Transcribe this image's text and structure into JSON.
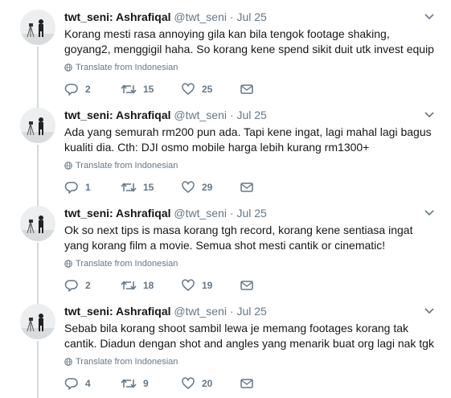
{
  "tweets": [
    {
      "display_name": "twt_seni: Ashrafiqal",
      "handle": "@twt_seni",
      "separator": "·",
      "date": "Jul 25",
      "text": "Korang mesti rasa annoying gila kan bila tengok footage shaking, goyang2, menggigil haha. So korang kene spend sikit duit utk invest equip",
      "translate_label": "Translate from Indonesian",
      "replies": "2",
      "retweets": "15",
      "likes": "25"
    },
    {
      "display_name": "twt_seni: Ashrafiqal",
      "handle": "@twt_seni",
      "separator": "·",
      "date": "Jul 25",
      "text": "Ada yang semurah rm200 pun ada. Tapi kene ingat, lagi mahal lagi bagus kualiti dia. Cth: DJI osmo mobile harga lebih kurang rm1300+",
      "translate_label": "Translate from Indonesian",
      "replies": "1",
      "retweets": "15",
      "likes": "29"
    },
    {
      "display_name": "twt_seni: Ashrafiqal",
      "handle": "@twt_seni",
      "separator": "·",
      "date": "Jul 25",
      "text": "Ok so next tips is masa korang tgh record, korang kene sentiasa ingat yang korang film a movie. Semua shot mesti cantik or cinematic!",
      "translate_label": "Translate from Indonesian",
      "replies": "2",
      "retweets": "18",
      "likes": "19"
    },
    {
      "display_name": "twt_seni: Ashrafiqal",
      "handle": "@twt_seni",
      "separator": "·",
      "date": "Jul 25",
      "text": "Sebab bila korang shoot sambil lewa je memang footages korang tak cantik. Diadun dengan shot and angles yang menarik buat org lagi nak tgk",
      "translate_label": "Translate from Indonesian",
      "replies": "4",
      "retweets": "9",
      "likes": "20"
    }
  ],
  "colors": {
    "text": "#14171a",
    "muted": "#657786",
    "thread_line": "#cfd9de"
  },
  "icons": [
    "chevron-down-icon",
    "globe-icon",
    "reply-icon",
    "retweet-icon",
    "like-icon",
    "direct-message-icon"
  ]
}
